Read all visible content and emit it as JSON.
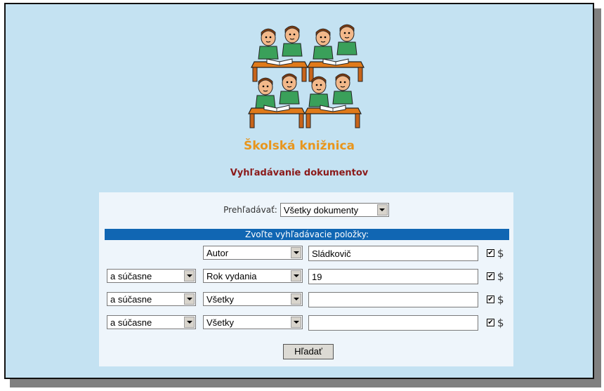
{
  "header": {
    "library_title": "Školská knižnica",
    "page_subtitle": "Vyhľadávanie dokumentov"
  },
  "search": {
    "scope_label": "Prehľadávať:",
    "scope_value": "Všetky dokumenty",
    "criteria_header": "Zvoľte vyhľadávacie položky:",
    "rows": [
      {
        "operator": "",
        "field": "Autor",
        "term": "Sládkovič",
        "checked": true,
        "checkbox_glyph": "✔",
        "suffix": "$"
      },
      {
        "operator": "a súčasne",
        "field": "Rok vydania",
        "term": "19",
        "checked": true,
        "checkbox_glyph": "✔",
        "suffix": "$"
      },
      {
        "operator": "a súčasne",
        "field": "Všetky",
        "term": "",
        "checked": true,
        "checkbox_glyph": "✔",
        "suffix": "$"
      },
      {
        "operator": "a súčasne",
        "field": "Všetky",
        "term": "",
        "checked": true,
        "checkbox_glyph": "✔",
        "suffix": "$"
      }
    ],
    "submit_label": "Hľadať"
  },
  "colors": {
    "page_bg": "#c4e2f2",
    "panel_bg": "#eef5fb",
    "title_orange": "#e8961e",
    "subtitle_red": "#8b1a1a",
    "header_blue": "#1066b3"
  },
  "icons": {
    "logo": "students-reading-at-desks-illustration",
    "dropdown": "dropdown-arrow-icon",
    "checkbox": "checkmark-icon"
  }
}
